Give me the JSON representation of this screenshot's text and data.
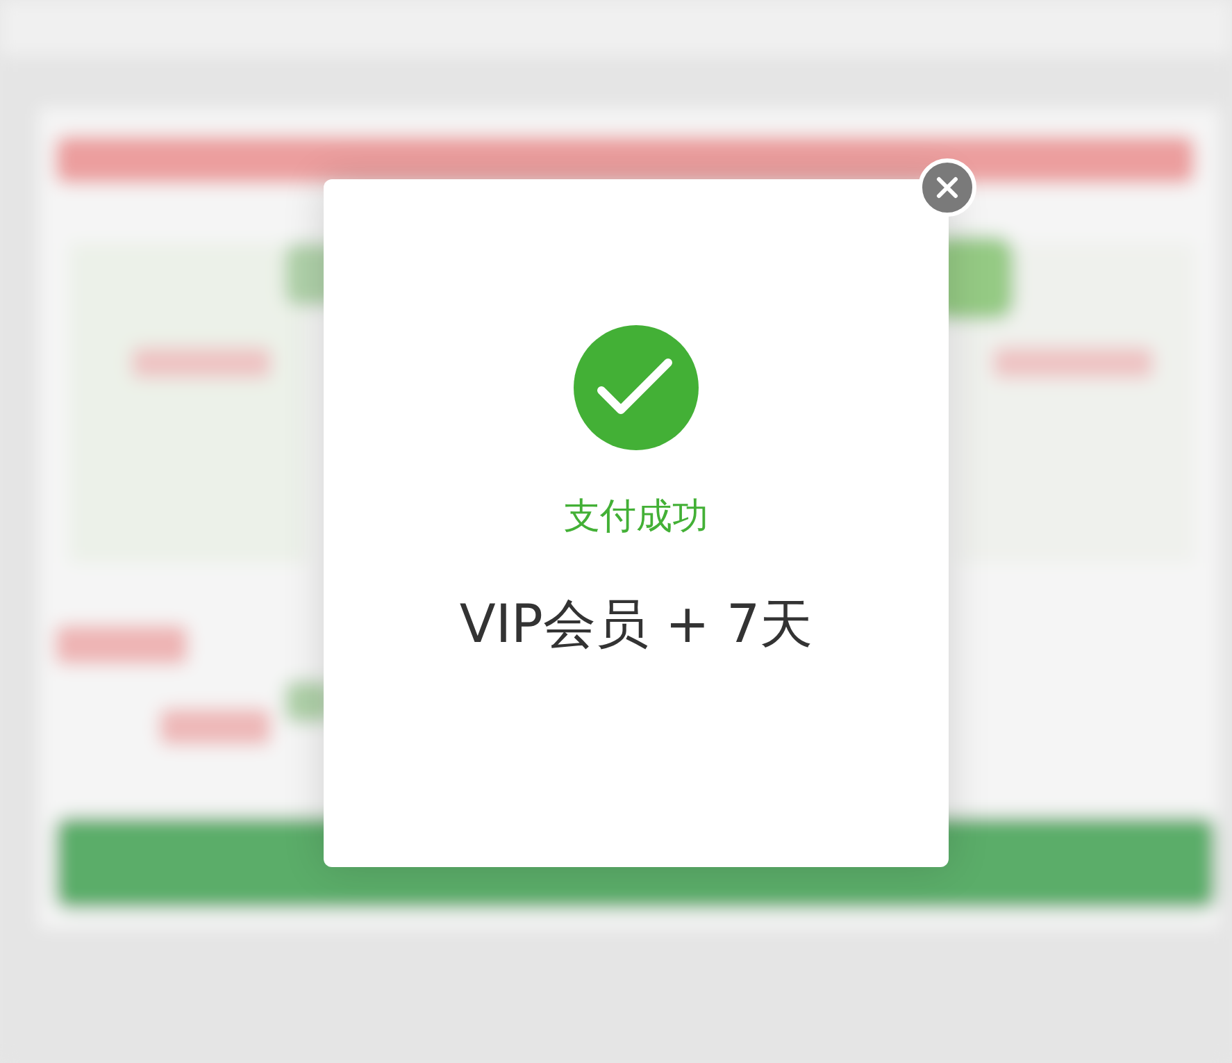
{
  "dialog": {
    "success": true,
    "title": "支付成功",
    "message": "VIP会员 + 7天"
  }
}
